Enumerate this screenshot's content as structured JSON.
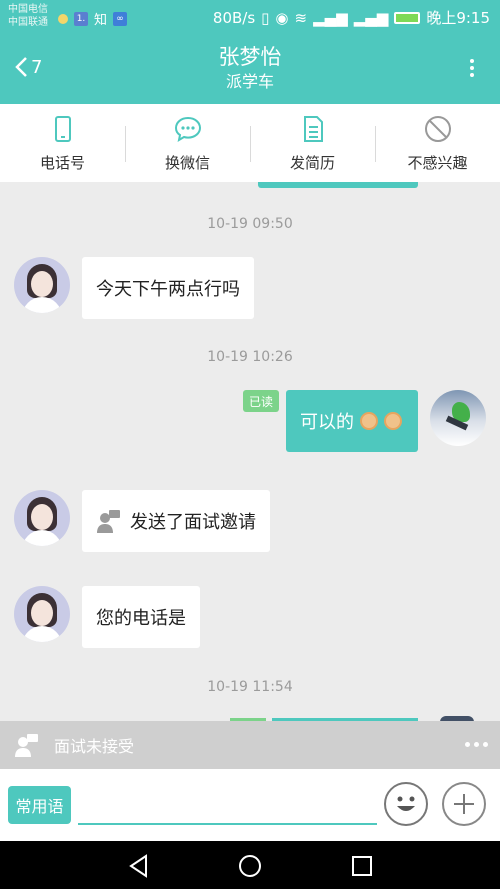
{
  "status_bar": {
    "carrier_1": "中国电信",
    "carrier_2": "中国联通",
    "app_icon_1": "1.",
    "app_icon_2": "知",
    "speed": "80B/s",
    "time": "晚上9:15",
    "battery_color": "#7ed957"
  },
  "header": {
    "back_count": "7",
    "title": "张梦怡",
    "subtitle": "派学车",
    "color": "#4ec8be"
  },
  "actions": [
    {
      "label": "电话号",
      "icon": "phone-icon"
    },
    {
      "label": "换微信",
      "icon": "chat-bubble-icon"
    },
    {
      "label": "发简历",
      "icon": "document-icon"
    },
    {
      "label": "不感兴趣",
      "icon": "prohibited-icon"
    }
  ],
  "chat": {
    "timestamps": [
      "10-19 09:50",
      "10-19 10:26",
      "10-19 11:54"
    ],
    "messages": [
      {
        "from": "them",
        "text": "今天下午两点行吗"
      },
      {
        "from": "me",
        "text": "可以的",
        "status": "已读",
        "emojis": [
          "ok-hand-emoji",
          "ok-hand-emoji"
        ]
      },
      {
        "from": "them",
        "text": "发送了面试邀请",
        "icon": "interview-icon"
      },
      {
        "from": "them",
        "text": "您的电话是"
      }
    ]
  },
  "system_bar": {
    "text": "面试未接受",
    "icon": "interview-icon"
  },
  "input_bar": {
    "phrases_label": "常用语",
    "input_value": "",
    "emoji_icon": "smiley-icon",
    "plus_icon": "plus-icon"
  },
  "nav_bar": {
    "icons": [
      "back-triangle-icon",
      "home-circle-icon",
      "recent-square-icon"
    ]
  }
}
